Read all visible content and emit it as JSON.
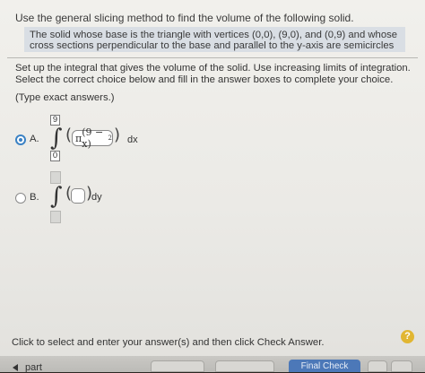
{
  "question": {
    "header": "Use the general slicing method to find the volume of the following solid.",
    "problem": "The solid whose base is the triangle with vertices (0,0), (9,0), and (0,9) and whose cross sections perpendicular to the base and parallel to the y-axis are semicircles"
  },
  "instructions": "Set up the integral that gives the volume of the solid. Use increasing limits of integration. Select the correct choice below and fill in the answer boxes to complete your choice.",
  "hint": "(Type exact answers.)",
  "options": [
    {
      "label": "A.",
      "selected": true,
      "upper_limit": "9",
      "lower_limit": "0",
      "integrand_pi": "π",
      "integrand_expr": "(9 − x)",
      "integrand_exp": "2",
      "differential": "dx"
    },
    {
      "label": "B.",
      "selected": false,
      "upper_limit": "",
      "lower_limit": "",
      "integrand": "",
      "differential": "dy"
    }
  ],
  "integral_symbol": "∫",
  "footer": {
    "instruction": "Click to select and enter your answer(s) and then click Check Answer.",
    "help": "?",
    "part_label": "part",
    "final_check": "Final Check"
  },
  "colors": {
    "accent": "#3b82c4",
    "problem_bg": "#d9dee4",
    "help_bg": "#e1b632",
    "final_check_bg": "#4c78b8"
  }
}
